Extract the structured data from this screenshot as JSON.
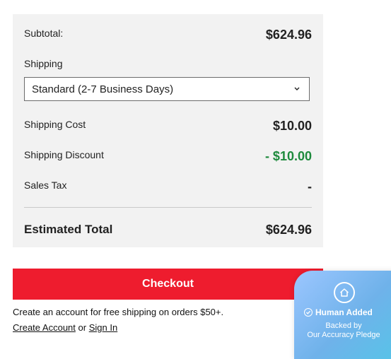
{
  "summary": {
    "subtotal_label": "Subtotal:",
    "subtotal_value": "$624.96",
    "shipping_label": "Shipping",
    "shipping_selected": "Standard (2-7 Business Days)",
    "shipping_cost_label": "Shipping Cost",
    "shipping_cost_value": "$10.00",
    "shipping_discount_label": "Shipping Discount",
    "shipping_discount_value": "- $10.00",
    "sales_tax_label": "Sales Tax",
    "sales_tax_value": "-",
    "estimated_total_label": "Estimated Total",
    "estimated_total_value": "$624.96"
  },
  "checkout": {
    "button_label": "Checkout",
    "note": "Create an account for free shipping on orders $50+.",
    "create_account_link": "Create Account",
    "or_text": "or",
    "sign_in_link": "Sign In"
  },
  "badge": {
    "title": "Human Added",
    "line1": "Backed by",
    "line2": "Our Accuracy Pledge",
    "icon": "home-icon"
  },
  "colors": {
    "checkout_red": "#ee1c2e",
    "discount_green": "#1e8a3d",
    "panel_bg": "#f2f2f2"
  }
}
